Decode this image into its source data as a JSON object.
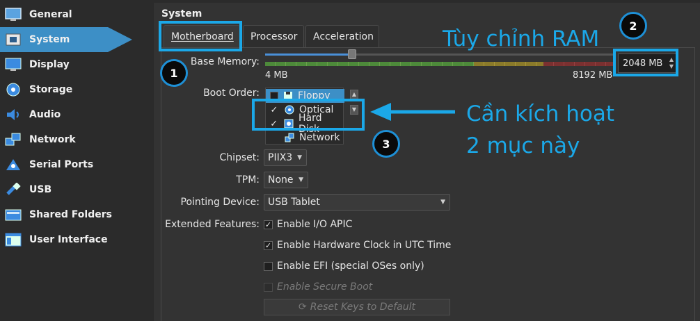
{
  "sidebar": {
    "items": [
      {
        "label": "General",
        "icon": "monitor-icon"
      },
      {
        "label": "System",
        "icon": "chip-icon",
        "active": true
      },
      {
        "label": "Display",
        "icon": "display-icon"
      },
      {
        "label": "Storage",
        "icon": "storage-icon"
      },
      {
        "label": "Audio",
        "icon": "speaker-icon"
      },
      {
        "label": "Network",
        "icon": "network-icon"
      },
      {
        "label": "Serial Ports",
        "icon": "serial-port-icon"
      },
      {
        "label": "USB",
        "icon": "usb-icon"
      },
      {
        "label": "Shared Folders",
        "icon": "folder-icon"
      },
      {
        "label": "User Interface",
        "icon": "window-icon"
      }
    ]
  },
  "main": {
    "section_title": "System",
    "tabs": [
      {
        "label": "Motherboard",
        "active": true
      },
      {
        "label": "Processor"
      },
      {
        "label": "Acceleration"
      }
    ],
    "base_memory": {
      "label": "Base Memory:",
      "min_label": "4 MB",
      "max_label": "8192 MB",
      "value": "2048 MB",
      "fraction": 0.25
    },
    "boot_order": {
      "label": "Boot Order:",
      "items": [
        {
          "label": "Floppy",
          "checked": false,
          "selected": true,
          "icon": "floppy-icon"
        },
        {
          "label": "Optical",
          "checked": true,
          "selected": false,
          "icon": "optical-disc-icon"
        },
        {
          "label": "Hard Disk",
          "checked": true,
          "selected": false,
          "icon": "hard-disk-icon"
        },
        {
          "label": "Network",
          "checked": false,
          "selected": false,
          "icon": "network-icon"
        }
      ]
    },
    "chipset": {
      "label": "Chipset:",
      "value": "PIIX3"
    },
    "tpm": {
      "label": "TPM:",
      "value": "None"
    },
    "pointing_device": {
      "label": "Pointing Device:",
      "value": "USB Tablet"
    },
    "extended_features": {
      "label": "Extended Features:",
      "options": [
        {
          "label": "Enable I/O APIC",
          "checked": true,
          "enabled": true
        },
        {
          "label": "Enable Hardware Clock in UTC Time",
          "checked": true,
          "enabled": true
        },
        {
          "label": "Enable EFI (special OSes only)",
          "checked": false,
          "enabled": true
        },
        {
          "label": "Enable Secure Boot",
          "checked": false,
          "enabled": false
        }
      ]
    },
    "reset_keys_label": "Reset Keys to Default"
  },
  "annotations": {
    "badge1": "1",
    "badge2": "2",
    "badge3": "3",
    "ram_note": "Tùy chỉnh RAM",
    "boot_note_line1": "Cần kích hoạt",
    "boot_note_line2": "2 mục này",
    "accent_color": "#1ba8e8"
  }
}
